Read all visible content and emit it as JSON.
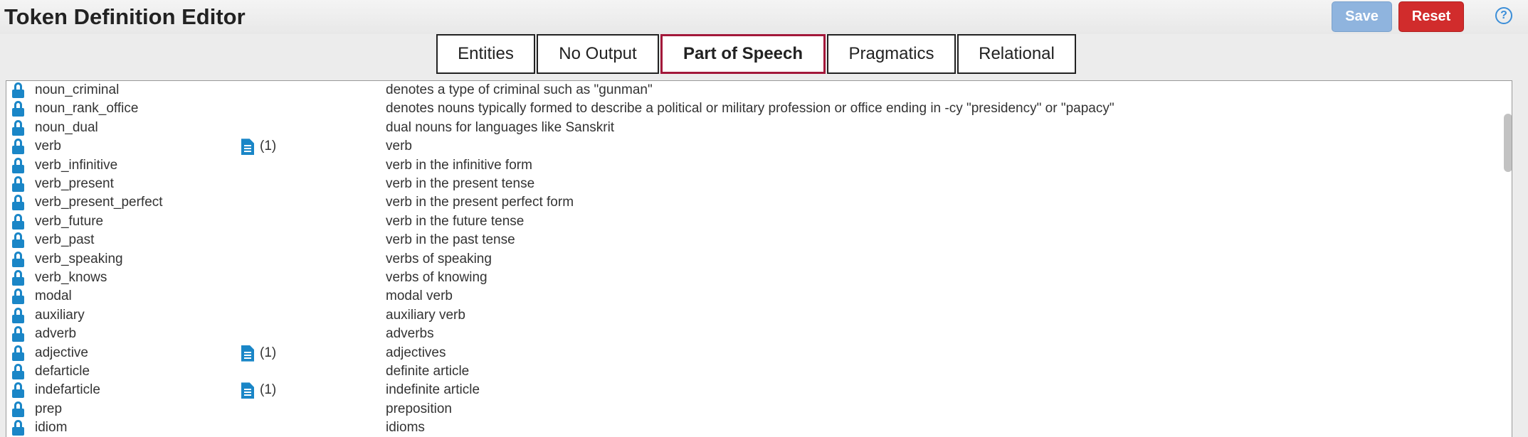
{
  "header": {
    "title": "Token Definition Editor",
    "save_label": "Save",
    "reset_label": "Reset",
    "help_label": "?"
  },
  "tabs": [
    {
      "label": "Entities",
      "active": false
    },
    {
      "label": "No Output",
      "active": false
    },
    {
      "label": "Part of Speech",
      "active": true
    },
    {
      "label": "Pragmatics",
      "active": false
    },
    {
      "label": "Relational",
      "active": false
    }
  ],
  "tokens": [
    {
      "name": "noun_criminal",
      "description": "denotes a type of criminal such as \"gunman\"",
      "locked": true,
      "doc_count": null
    },
    {
      "name": "noun_rank_office",
      "description": "denotes nouns typically formed to describe a political or military profession or office ending in -cy \"presidency\" or \"papacy\"",
      "locked": true,
      "doc_count": null
    },
    {
      "name": "noun_dual",
      "description": "dual nouns for languages like Sanskrit",
      "locked": true,
      "doc_count": null
    },
    {
      "name": "verb",
      "description": "verb",
      "locked": true,
      "doc_count": "(1)"
    },
    {
      "name": "verb_infinitive",
      "description": "verb in the infinitive form",
      "locked": true,
      "doc_count": null
    },
    {
      "name": "verb_present",
      "description": "verb in the present tense",
      "locked": true,
      "doc_count": null
    },
    {
      "name": "verb_present_perfect",
      "description": "verb in the present perfect form",
      "locked": true,
      "doc_count": null
    },
    {
      "name": "verb_future",
      "description": "verb in the future tense",
      "locked": true,
      "doc_count": null
    },
    {
      "name": "verb_past",
      "description": "verb in the past tense",
      "locked": true,
      "doc_count": null
    },
    {
      "name": "verb_speaking",
      "description": "verbs of speaking",
      "locked": true,
      "doc_count": null
    },
    {
      "name": "verb_knows",
      "description": "verbs of knowing",
      "locked": true,
      "doc_count": null
    },
    {
      "name": "modal",
      "description": "modal verb",
      "locked": true,
      "doc_count": null
    },
    {
      "name": "auxiliary",
      "description": "auxiliary verb",
      "locked": true,
      "doc_count": null
    },
    {
      "name": "adverb",
      "description": "adverbs",
      "locked": true,
      "doc_count": null
    },
    {
      "name": "adjective",
      "description": "adjectives",
      "locked": true,
      "doc_count": "(1)"
    },
    {
      "name": "defarticle",
      "description": "definite article",
      "locked": true,
      "doc_count": null
    },
    {
      "name": "indefarticle",
      "description": "indefinite article",
      "locked": true,
      "doc_count": "(1)"
    },
    {
      "name": "prep",
      "description": "preposition",
      "locked": true,
      "doc_count": null
    },
    {
      "name": "idiom",
      "description": "idioms",
      "locked": true,
      "doc_count": null
    }
  ],
  "colors": {
    "save": "#8fb4de",
    "reset": "#d12c2c",
    "active_tab_border": "#a3183a",
    "icon_blue": "#1a86c7"
  },
  "icons": {
    "lock": "lock-icon",
    "document": "document-icon",
    "help": "help-icon"
  }
}
